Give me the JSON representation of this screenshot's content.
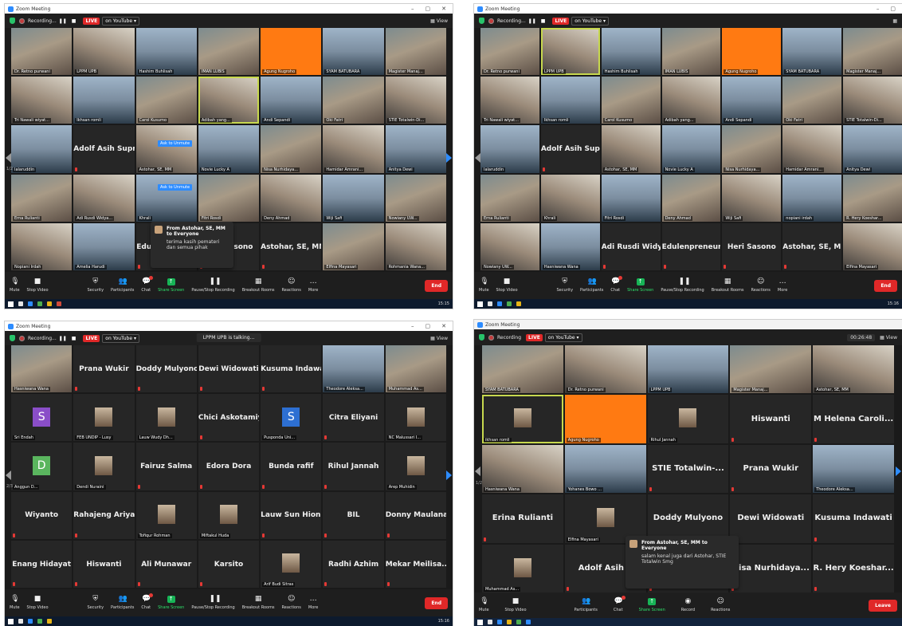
{
  "window_title": "Zoom Meeting",
  "recording": {
    "label": "Recording...",
    "live": "LIVE",
    "youtube": "on YouTube"
  },
  "view_label": "View",
  "panel2": {
    "recording_label": "Recording..."
  },
  "panel3": {
    "talking": "LPPM UPB is talking..."
  },
  "panel4": {
    "recording_label": "Recording",
    "timer": "00:26:48"
  },
  "toolbar": {
    "mute": "Mute",
    "stop_video": "Stop Video",
    "security": "Security",
    "participants": "Participants",
    "chat": "Chat",
    "share_screen": "Share Screen",
    "pause_recording": "Pause/Stop Recording",
    "breakout": "Breakout Rooms",
    "reactions": "Reactions",
    "more": "More",
    "end": "End",
    "record": "Record",
    "leave": "Leave"
  },
  "taskbar_time": {
    "p1": "15:15",
    "p2": "15:16",
    "p3": "15:16"
  },
  "panel1": {
    "tiles": [
      "Dr. Retno purwani",
      "LPPM UPB",
      "Hashim Buhlisah",
      "IMAN LUBIS",
      "Agung Nugroho",
      "SYAM BATUBARA",
      "Magister Manaj...",
      "Tri Nawali wiyat...",
      "Ikhsan romli",
      "Carol Kusumo",
      "Adibah yang...",
      "Andi Sepandi",
      "Oki Fatri",
      "STIE Totalwin-Di...",
      "Ialaruddin",
      "Adolf Asih Supr...",
      "Astohar, SE, MM",
      "Novie Lucky A",
      "Nisa Nurhidaya...",
      "Hamidar Amrani...",
      "Anitya Dewi",
      "Erna Rulianti",
      "Adi Rusdi Widya...",
      "Khrali",
      "Fitri Rosdi",
      "Deny Ahmad",
      "Wiji Safi",
      "Nowiany UW...",
      "Nopiani Irdah",
      "Amelia Harudi",
      "Edulenpreneur",
      "Heri Sasono",
      "Astohar, SE, MM",
      "Elfina Mayasari",
      "Rohmania Wana..."
    ],
    "ask_unmute": "Ask to Unmute",
    "chat": {
      "from": "From Astohar, SE, MM to Everyone",
      "msg": "terima kasih pemateri dan semua pihak"
    }
  },
  "panel2_tiles": [
    "Dr. Retno purwani",
    "LPPM UPB",
    "Hashim Buhlisah",
    "IMAN LUBIS",
    "Agung Nugroho",
    "SYAM BATUBARA",
    "Magister Manaj...",
    "Tri Nawali wiyat...",
    "Ikhsan romli",
    "Carol Kusumo",
    "Adibah yang...",
    "Andi Sepandi",
    "Oki Fatri",
    "STIE Totalwin-Di...",
    "Ialaruddin",
    "Adolf Asih Supr...",
    "Astohar, SE, MM",
    "Novie Lucky A",
    "Nisa Nurhidaya...",
    "Hamidar Amrani...",
    "Anitya Dewi",
    "Erna Rulianti",
    "Khrali",
    "Fitri Rosdi",
    "Deny Ahmad",
    "Wiji Safi",
    "nopiani irdah",
    "R. Hery Koeshar...",
    "Nowiany UW...",
    "Hasniwana Wana",
    "Adi Rusdi Widya",
    "Edulenpreneur",
    "Heri Sasono",
    "Astohar, SE, MM",
    "Elfina Mayasari"
  ],
  "panel3_tiles": [
    "Hasniwana Wana",
    "Prana Wukir",
    "Doddy Mulyono",
    "Dewi Widowati",
    "Kusuma Indawati",
    "Theodore Aleksa...",
    "Muhammad As...",
    "Sri Endah",
    "FEB UNDIP - Lusy",
    "Lauw Wudy Dh...",
    "Chici Askotamiya",
    "Pusponda Uni...",
    "Citra Eliyani",
    "NC Malussari I...",
    "Anggun D...",
    "Dendi Nuraini",
    "Fairuz Salma",
    "Edora Dora",
    "Bunda rafif",
    "Rihul Jannah",
    "Arep Muhidin",
    "Wiyanto",
    "Rahajeng Ariyani",
    "Tofiqur Rohman",
    "Miftakul Huda",
    "Lauw Sun Hion...",
    "BIL",
    "Donny Maulana",
    "Enang Hidayat",
    "Hiswanti",
    "Ali Munawar",
    "Karsito",
    "Arif Budi Sitras",
    "Radhi Azhim",
    "Mekar Meilisa..."
  ],
  "panel4_tiles": [
    "SYAM BATUBARA",
    "Dr. Retno purwani",
    "LPPM UPB",
    "Magister Manaj...",
    "Astohar, SE, MM",
    "ikhsan romli",
    "Agung Nugroho",
    "Rihul Jannah",
    "Hiswanti",
    "M Helena Caroli...",
    "Hasniwana Wana",
    "Yohanes Bowo ...",
    "STIE Totalwin-...",
    "Prana Wukir",
    "Theodore Aleksa...",
    "Erina Rulianti",
    "Elfina Mayasari",
    "Doddy Mulyono",
    "Dewi Widowati",
    "Kusuma Indawati",
    "Muhammad As...",
    "Adolf Asih S",
    "",
    "Nisa Nurhidaya...",
    "R. Hery Koeshar..."
  ],
  "panel4_chat": {
    "from": "From Astohar, SE, MM to Everyone",
    "msg": "salam kenal juga dari Astohar, STIE Totalwin Smg"
  },
  "panel3_avatars": {
    "s1": "S",
    "s2": "S",
    "d": "D"
  },
  "pages": {
    "p1": "1/2",
    "p3": "2/3",
    "p4": "1/2"
  },
  "colors": {
    "accent": "#2d8cff",
    "live": "#e02828",
    "share": "#17b456",
    "active_speaker": "#c7d84e"
  }
}
